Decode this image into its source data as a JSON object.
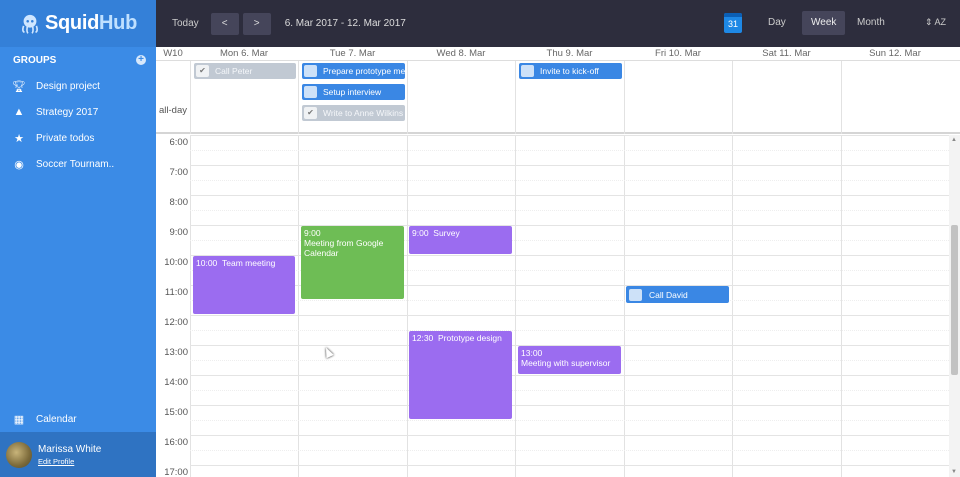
{
  "app": {
    "brand_a": "Squid",
    "brand_b": "Hub"
  },
  "sidebar": {
    "groups_label": "GROUPS",
    "items": [
      {
        "label": "Design project",
        "icon": "trophy-icon"
      },
      {
        "label": "Strategy 2017",
        "icon": "rocket-icon"
      },
      {
        "label": "Private todos",
        "icon": "star-icon"
      },
      {
        "label": "Soccer Tournam..",
        "icon": "soccer-ball-icon"
      }
    ],
    "calendar_label": "Calendar",
    "user": {
      "name": "Marissa White",
      "link": "Edit Profile"
    }
  },
  "toolbar": {
    "today": "Today",
    "prev": "<",
    "next": ">",
    "range": "6. Mar 2017 - 12. Mar 2017",
    "cal_icon_day": "31",
    "views": [
      "Day",
      "Week",
      "Month"
    ],
    "active_view": "Week",
    "sort": "⇕ AZ"
  },
  "calendar": {
    "week": "W10",
    "days": [
      "Mon 6. Mar",
      "Tue 7. Mar",
      "Wed 8. Mar",
      "Thu 9. Mar",
      "Fri 10. Mar",
      "Sat 11. Mar",
      "Sun 12. Mar"
    ],
    "allday_label": "all-day",
    "hours": [
      "6:00",
      "7:00",
      "8:00",
      "9:00",
      "10:00",
      "11:00",
      "12:00",
      "13:00",
      "14:00",
      "15:00",
      "16:00",
      "17:00"
    ],
    "allday_events": [
      {
        "title": "Call Peter",
        "done": true
      },
      {
        "title": "Prepare prototype meet",
        "done": false
      },
      {
        "title": "Setup interview",
        "done": false
      },
      {
        "title": "Write to Anne Wilkins",
        "done": true
      },
      {
        "title": "Invite to kick-off",
        "done": false
      }
    ],
    "events": [
      {
        "time": "10:00",
        "title": "Team meeting"
      },
      {
        "time": "9:00",
        "title": "Meeting from Google Calendar"
      },
      {
        "time": "9:00",
        "title": "Survey"
      },
      {
        "time": "12:30",
        "title": "Prototype design"
      },
      {
        "time": "13:00",
        "title": "Meeting with supervisor"
      },
      {
        "time": "",
        "title": "Call David"
      }
    ]
  },
  "colors": {
    "sidebar": "#3b8be6",
    "topbar": "#2d2d3d",
    "event_purple": "#9b6cf0",
    "event_green": "#6ebd55",
    "event_blue": "#3a87e4"
  }
}
